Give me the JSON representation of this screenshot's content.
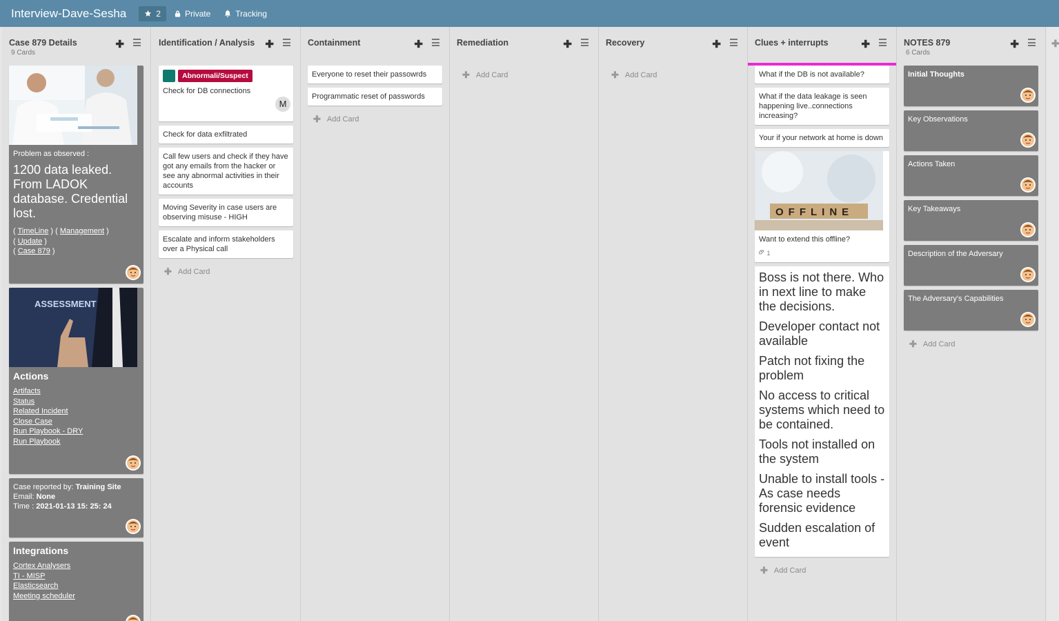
{
  "board": {
    "title": "Interview-Dave-Sesha",
    "star_count": "2",
    "privacy": "Private",
    "tracking": "Tracking"
  },
  "icons": {
    "star": "star-icon",
    "lock": "lock-icon",
    "bell": "bell-icon",
    "plus": "plus-icon",
    "menu": "hamburger-menu-icon",
    "avatar": "user-avatar-icon",
    "paperclip": "paperclip-icon"
  },
  "colors": {
    "header_bg": "#5a8aa8",
    "label_teal": "#0f7a6e",
    "label_red": "#b60b3e",
    "highlight": "#e82bd3",
    "dark_card": "#7c7c7c"
  },
  "common": {
    "add_card": "Add Card"
  },
  "lists": {
    "details": {
      "title": "Case 879 Details",
      "count": "9 Cards",
      "problem_label": "Problem as observed :",
      "problem_text": "1200 data leaked. From LADOK database. Credential lost.",
      "links": [
        "TimeLine",
        "Management",
        "Update",
        "Case 879"
      ],
      "actions_image_text": "ASSESSMENT",
      "actions_title": "Actions",
      "actions_links": [
        "Artifacts",
        "Status",
        "Related Incident",
        "Close Case",
        "Run Playbook - DRY",
        "Run Playbook"
      ],
      "reported_by_label": "Case reported by:",
      "reported_by": "Training Site",
      "email_label": "Email:",
      "email": "None",
      "time_label": "Time :",
      "time": "2021-01-13 15: 25: 24",
      "integrations_title": "Integrations",
      "integrations_links": [
        "Cortex Analysers",
        "TI - MISP",
        "Elasticsearch",
        "Meeting scheduler"
      ]
    },
    "identification": {
      "title": "Identification / Analysis",
      "label": "Abnormali/Suspect",
      "member_initial": "M",
      "cards": [
        "Check for DB connections",
        "Check for data exfiltrated",
        "Call few users and check if they have got any emails from the hacker or see any abnormal activities in their accounts",
        "Moving Severity in case users are observing misuse - HIGH",
        "Escalate and inform stakeholders over a Physical call"
      ]
    },
    "containment": {
      "title": "Containment",
      "cards": [
        "Everyone to reset their passowrds",
        "Programmatic reset of passwords"
      ]
    },
    "remediation": {
      "title": "Remediation"
    },
    "recovery": {
      "title": "Recovery"
    },
    "clues": {
      "title": "Clues + interrupts",
      "cards": [
        "What if the DB is not available?",
        "What if the data leakage is seen happening live..connections increasing?",
        "Your if your network at home is down"
      ],
      "offline_image_text": "OFFLINE",
      "offline_card": "Want to extend this offline?",
      "offline_attachments": "1",
      "big_card": [
        "Boss is not there. Who in next line to make the decisions.",
        "Developer contact not available",
        "Patch not fixing the problem",
        "No access to critical systems which need to be contained.",
        "Tools not installed on the system",
        "Unable to install tools - As case needs forensic evidence",
        "Sudden escalation of event"
      ]
    },
    "notes": {
      "title": "NOTES 879",
      "count": "6 Cards",
      "cards": [
        "Initial Thoughts",
        "Key Observations",
        "Actions Taken",
        "Key Takeaways",
        "Description of the Adversary",
        "The Adversary's Capabilities"
      ]
    }
  }
}
